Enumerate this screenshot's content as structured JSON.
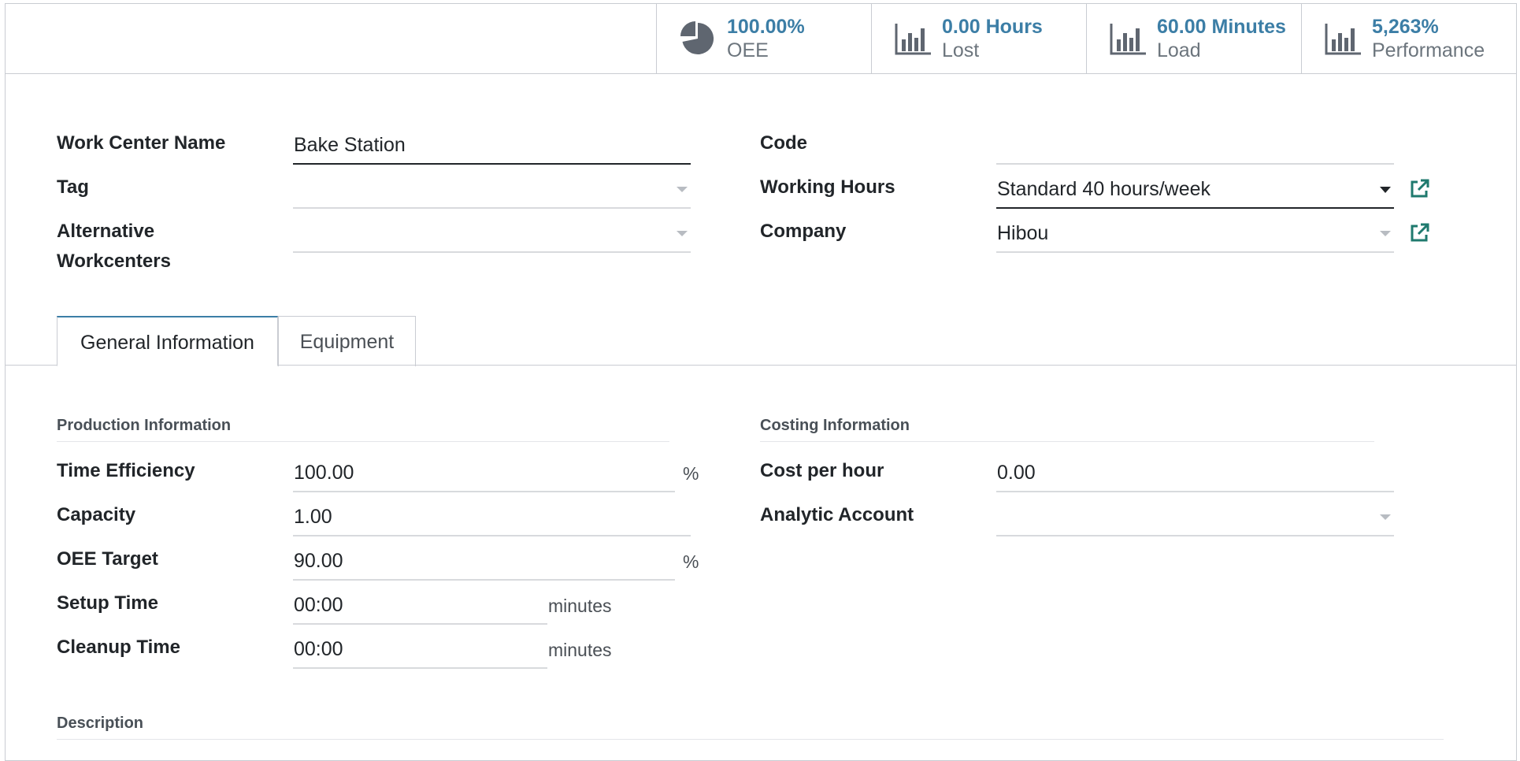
{
  "stats": [
    {
      "value": "100.00%",
      "label": "OEE",
      "icon": "pie-chart-icon"
    },
    {
      "value": "0.00 Hours",
      "label": "Lost",
      "icon": "bar-chart-icon"
    },
    {
      "value": "60.00 Minutes",
      "label": "Load",
      "icon": "bar-chart-icon"
    },
    {
      "value": "5,263%",
      "label": "Performance",
      "icon": "bar-chart-icon"
    }
  ],
  "form": {
    "work_center_name_label": "Work Center Name",
    "work_center_name_value": "Bake Station",
    "tag_label": "Tag",
    "tag_value": "",
    "alt_workcenters_label_1": "Alternative",
    "alt_workcenters_label_2": "Workcenters",
    "alt_workcenters_value": "",
    "code_label": "Code",
    "code_value": "",
    "working_hours_label": "Working Hours",
    "working_hours_value": "Standard 40 hours/week",
    "company_label": "Company",
    "company_value": "Hibou"
  },
  "tabs": [
    {
      "label": "General Information",
      "active": true
    },
    {
      "label": "Equipment",
      "active": false
    }
  ],
  "production": {
    "title": "Production Information",
    "time_efficiency_label": "Time Efficiency",
    "time_efficiency_value": "100.00",
    "time_efficiency_unit": "%",
    "capacity_label": "Capacity",
    "capacity_value": "1.00",
    "oee_target_label": "OEE Target",
    "oee_target_value": "90.00",
    "oee_target_unit": "%",
    "setup_time_label": "Setup Time",
    "setup_time_value": "00:00",
    "setup_time_unit": "minutes",
    "cleanup_time_label": "Cleanup Time",
    "cleanup_time_value": "00:00",
    "cleanup_time_unit": "minutes"
  },
  "costing": {
    "title": "Costing Information",
    "cost_per_hour_label": "Cost per hour",
    "cost_per_hour_value": "0.00",
    "analytic_account_label": "Analytic Account",
    "analytic_account_value": ""
  },
  "description": {
    "title": "Description"
  },
  "colors": {
    "accent": "#3c7ea6",
    "link_icon": "#1f7a6e",
    "border": "#c9ccd2"
  }
}
